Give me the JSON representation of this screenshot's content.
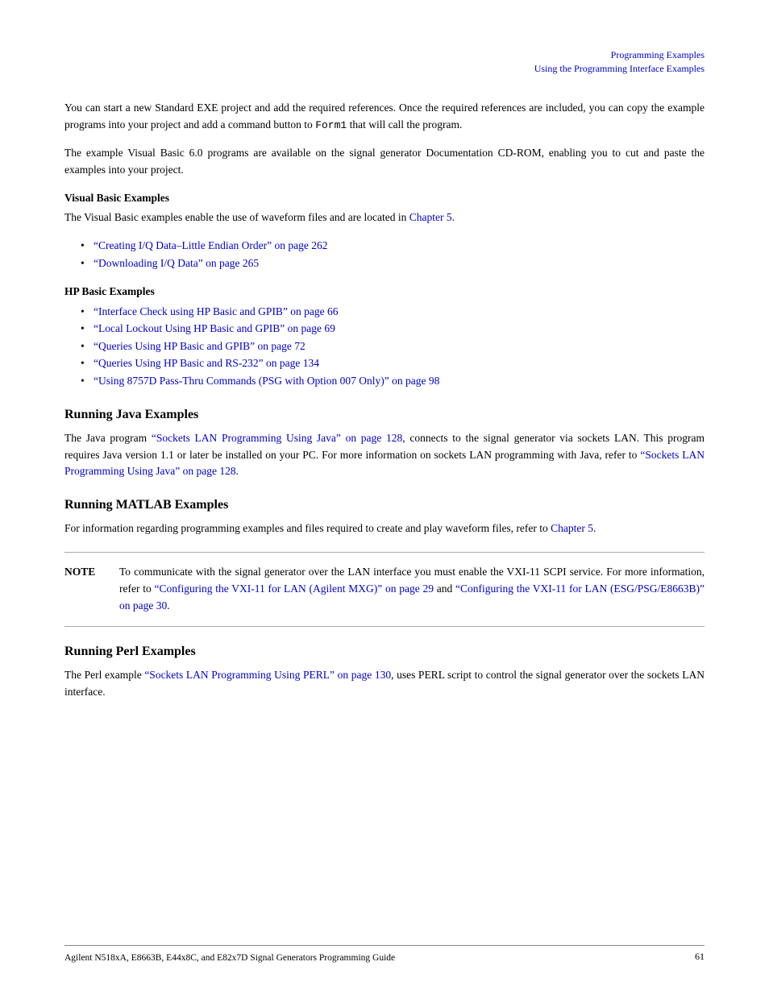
{
  "header": {
    "line1": "Programming Examples",
    "line2": "Using the Programming Interface Examples"
  },
  "intro_para1": "You can start a new Standard EXE project and add the required references. Once the required references are included, you can copy the example programs into your project and add a command button to ",
  "intro_code": "Form1",
  "intro_para1_end": " that will call the program.",
  "intro_para2": "The example Visual Basic 6.0 programs are available on the signal generator Documentation CD-ROM, enabling you to cut and paste the examples into your project.",
  "vb_heading": "Visual Basic Examples",
  "vb_intro": "The Visual Basic examples enable the use of waveform files and are located in ",
  "vb_intro_link": "Chapter 5",
  "vb_bullets": [
    {
      "text": "“Creating I/Q Data–Little Endian Order” on page 262",
      "link": true
    },
    {
      "text": "“Downloading I/Q Data” on page 265",
      "link": true
    }
  ],
  "hp_heading": "HP Basic Examples",
  "hp_bullets": [
    {
      "text": "“Interface Check using HP Basic and GPIB” on page 66",
      "link": true
    },
    {
      "text": "“Local Lockout Using HP Basic and GPIB” on page 69",
      "link": true
    },
    {
      "text": "“Queries Using HP Basic and GPIB” on page 72",
      "link": true
    },
    {
      "text": "“Queries Using HP Basic and RS-232” on page 134",
      "link": true
    },
    {
      "text": "“Using 8757D Pass-Thru Commands (PSG with Option 007 Only)” on page 98",
      "link": true
    }
  ],
  "java_heading": "Running Java Examples",
  "java_para": "The Java program ",
  "java_link1": "“Sockets LAN Programming Using Java” on page 128",
  "java_para2": ", connects to the signal generator via sockets LAN. This program requires Java version 1.1 or later be installed on your PC. For more information on sockets LAN programming with Java, refer to ",
  "java_link2": "“Sockets LAN Programming Using Java” on page 128",
  "java_para3": ".",
  "matlab_heading": "Running MATLAB Examples",
  "matlab_para": "For information regarding programming examples and files required to create and play waveform files, refer to ",
  "matlab_link": "Chapter 5",
  "matlab_para2": ".",
  "note_label": "NOTE",
  "note_text1": "To communicate with the signal generator over the LAN interface you must enable the VXI-11 SCPI service. For more information, refer to ",
  "note_link1": "“Configuring the VXI-11 for LAN (Agilent MXG)” on page 29",
  "note_text2": " and ",
  "note_link2": "“Configuring the VXI-11 for LAN (ESG/PSG/E8663B)” on page 30",
  "note_text3": ".",
  "perl_heading": "Running Perl Examples",
  "perl_para1": "The Perl example ",
  "perl_link": "“Sockets LAN Programming Using PERL” on page 130",
  "perl_para2": ", uses PERL script to control the signal generator over the sockets LAN interface.",
  "footer_left": "Agilent N518xA, E8663B, E44x8C, and E82x7D Signal Generators Programming Guide",
  "footer_right": "61"
}
